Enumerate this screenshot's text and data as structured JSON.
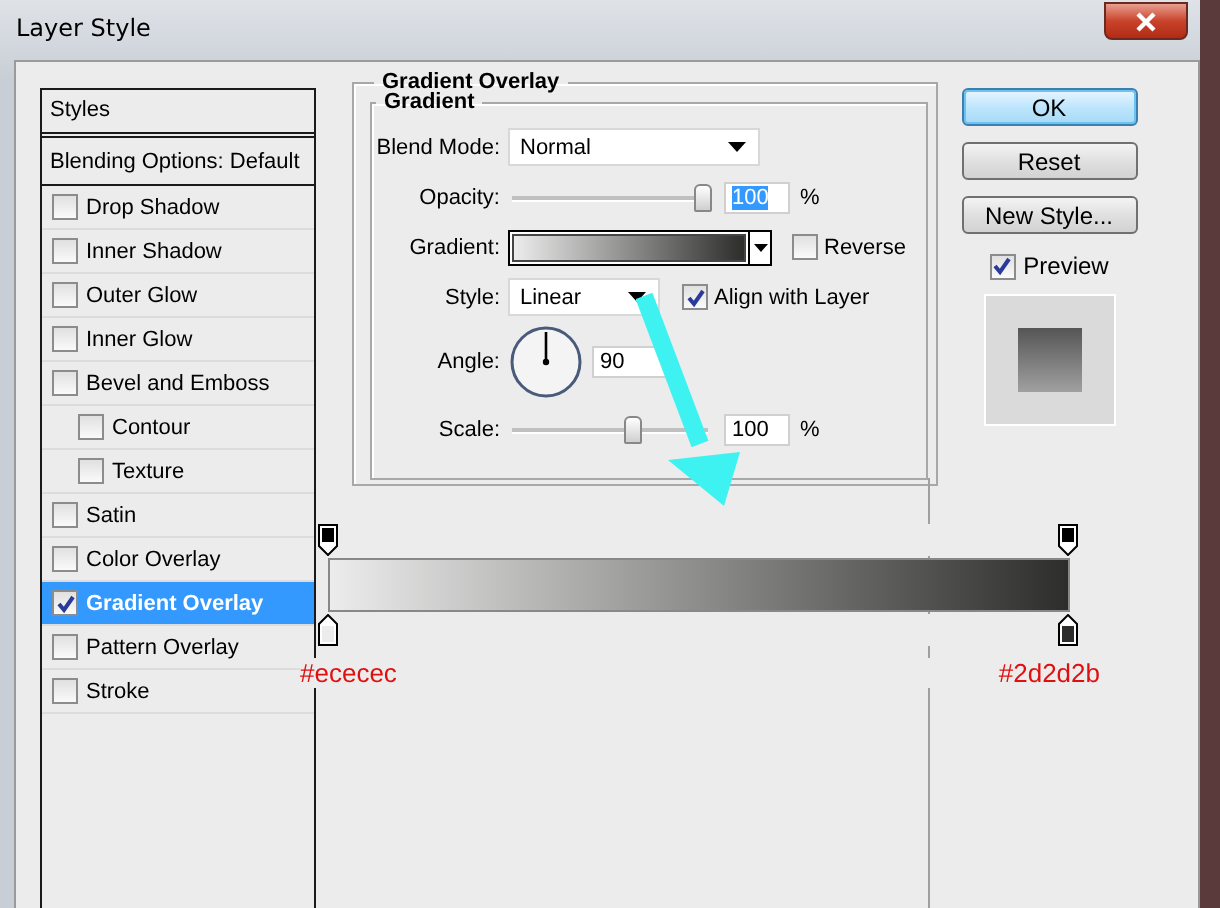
{
  "window": {
    "title": "Layer Style"
  },
  "styles_panel": {
    "header": "Styles",
    "items": [
      {
        "kind": "option",
        "label": "Blending Options: Default",
        "selected": false
      },
      {
        "kind": "effect",
        "label": "Drop Shadow",
        "checked": false,
        "selected": false
      },
      {
        "kind": "effect",
        "label": "Inner Shadow",
        "checked": false,
        "selected": false
      },
      {
        "kind": "effect",
        "label": "Outer Glow",
        "checked": false,
        "selected": false
      },
      {
        "kind": "effect",
        "label": "Inner Glow",
        "checked": false,
        "selected": false
      },
      {
        "kind": "effect",
        "label": "Bevel and Emboss",
        "checked": false,
        "selected": false,
        "children": [
          {
            "kind": "effect",
            "label": "Contour",
            "checked": false,
            "selected": false
          },
          {
            "kind": "effect",
            "label": "Texture",
            "checked": false,
            "selected": false
          }
        ]
      },
      {
        "kind": "effect",
        "label": "Satin",
        "checked": false,
        "selected": false
      },
      {
        "kind": "effect",
        "label": "Color Overlay",
        "checked": false,
        "selected": false
      },
      {
        "kind": "effect",
        "label": "Gradient Overlay",
        "checked": true,
        "selected": true
      },
      {
        "kind": "effect",
        "label": "Pattern Overlay",
        "checked": false,
        "selected": false
      },
      {
        "kind": "effect",
        "label": "Stroke",
        "checked": false,
        "selected": false
      }
    ]
  },
  "gradient_overlay": {
    "title": "Gradient Overlay",
    "section": "Gradient",
    "blend_mode": {
      "label": "Blend Mode:",
      "value": "Normal"
    },
    "opacity": {
      "label": "Opacity:",
      "level": 1,
      "value": "100",
      "unit": "%",
      "highlighted": true
    },
    "gradient": {
      "label": "Gradient:"
    },
    "reverse": {
      "label": "Reverse",
      "checked": false
    },
    "style": {
      "label": "Style:",
      "value": "Linear"
    },
    "align_with_layer": {
      "label": "Align with Layer",
      "checked": true
    },
    "angle": {
      "label": "Angle:",
      "value": "90"
    },
    "scale": {
      "label": "Scale:",
      "level": 0.62,
      "value": "100",
      "unit": "%",
      "highlighted": false
    }
  },
  "buttons": [
    {
      "label": "OK",
      "default": true
    },
    {
      "label": "Reset",
      "default": false
    },
    {
      "label": "New Style...",
      "default": false
    }
  ],
  "preview": {
    "label": "Preview",
    "checked": true
  },
  "gradient_editor": {
    "stops": [
      {
        "color": "#ececec",
        "label": "#ececec"
      },
      {
        "color": "#2d2d2b",
        "label": "#2d2d2b"
      }
    ]
  }
}
